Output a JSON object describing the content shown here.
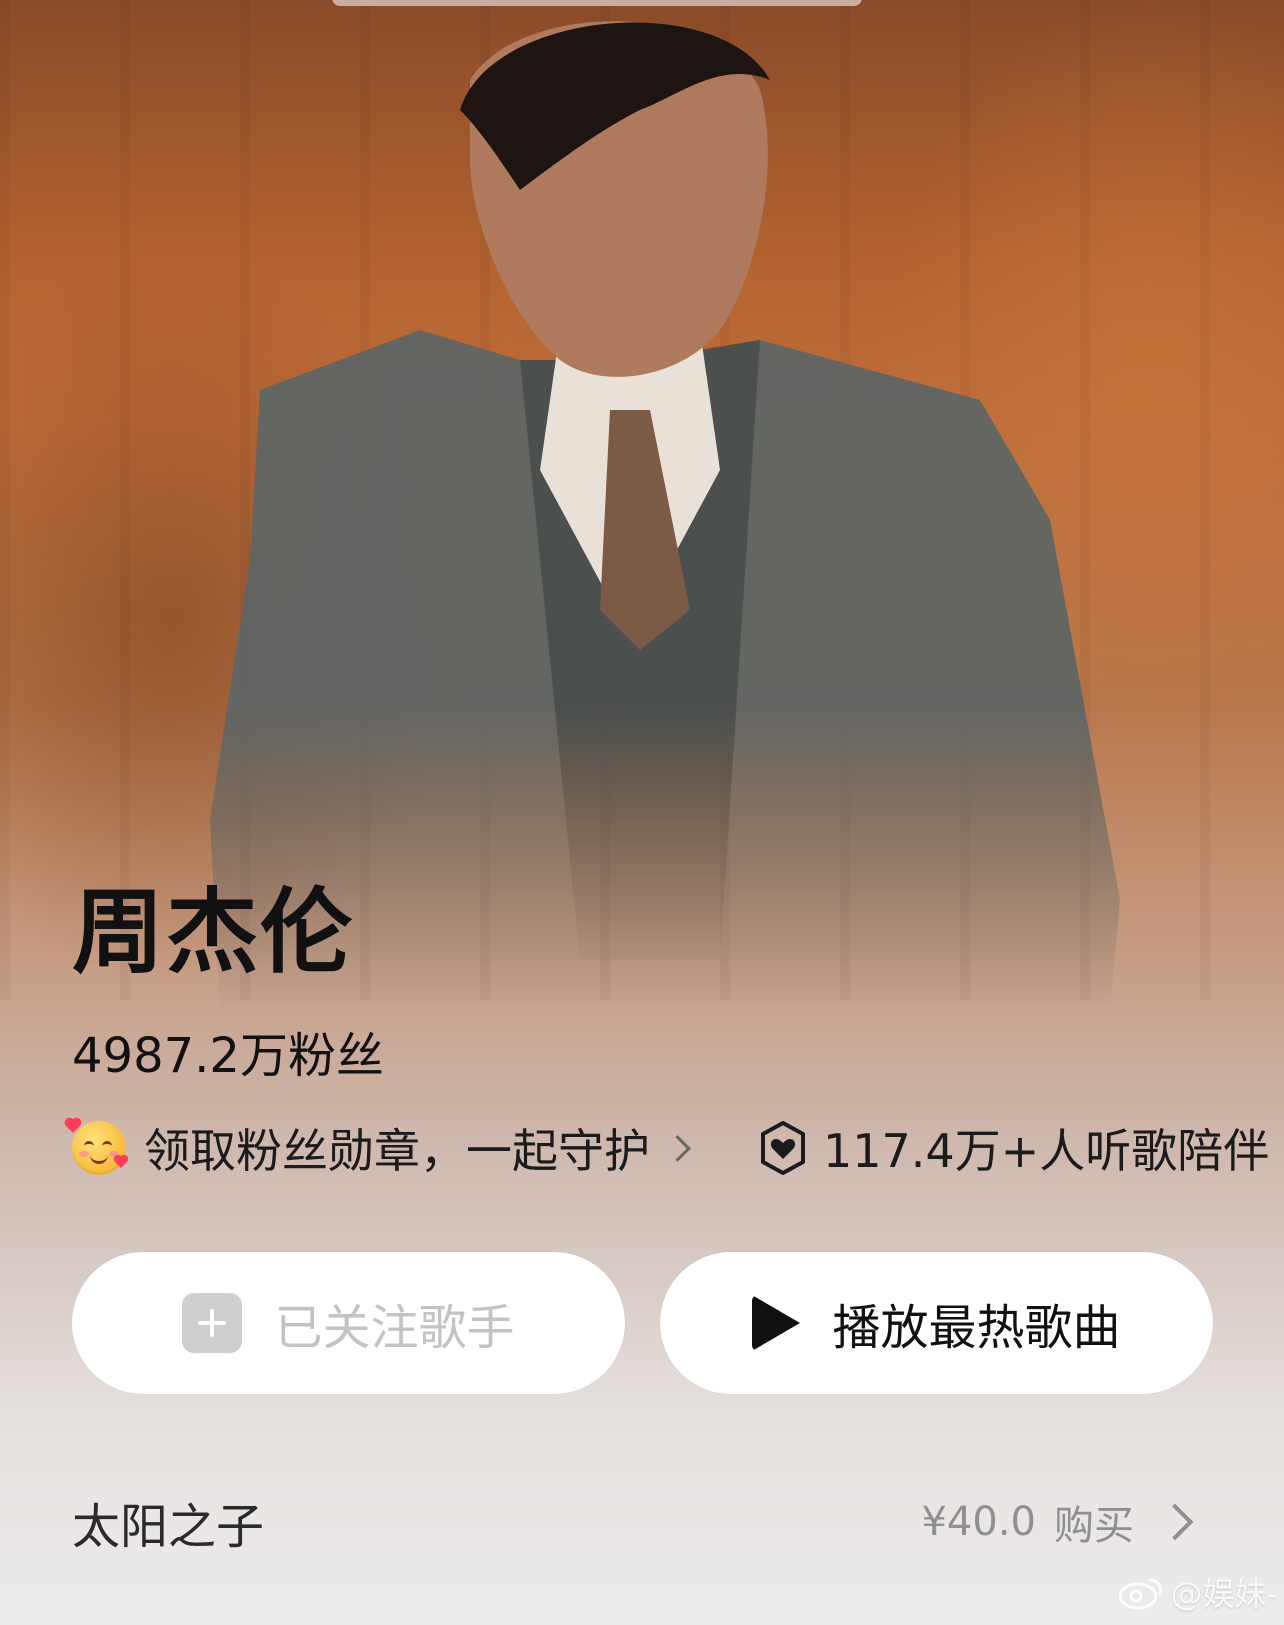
{
  "artist": {
    "name": "周杰伦",
    "followers": "4987.2万粉丝"
  },
  "badges": {
    "medal_text": "领取粉丝勋章，一起守护",
    "listeners_text": "117.4万+人听歌陪伴"
  },
  "actions": {
    "follow_label": "已关注歌手",
    "play_label": "播放最热歌曲"
  },
  "album": {
    "title": "太阳之子",
    "price": "¥40.0",
    "buy_label": "购买"
  },
  "watermark": {
    "text": "@娱妹-"
  },
  "icons": {
    "medal": "smiling-face-with-hearts-icon",
    "listeners": "heart-shield-icon",
    "follow": "plus-icon",
    "play": "play-icon",
    "chevron": "chevron-right-icon",
    "weibo": "weibo-logo-icon"
  },
  "colors": {
    "background_top": "#b3632f",
    "background_bottom": "#ecebeb",
    "text_primary": "#111111",
    "muted": "#8f8f8f",
    "button_bg": "#ffffff",
    "follow_disabled": "#c3c3c3"
  }
}
